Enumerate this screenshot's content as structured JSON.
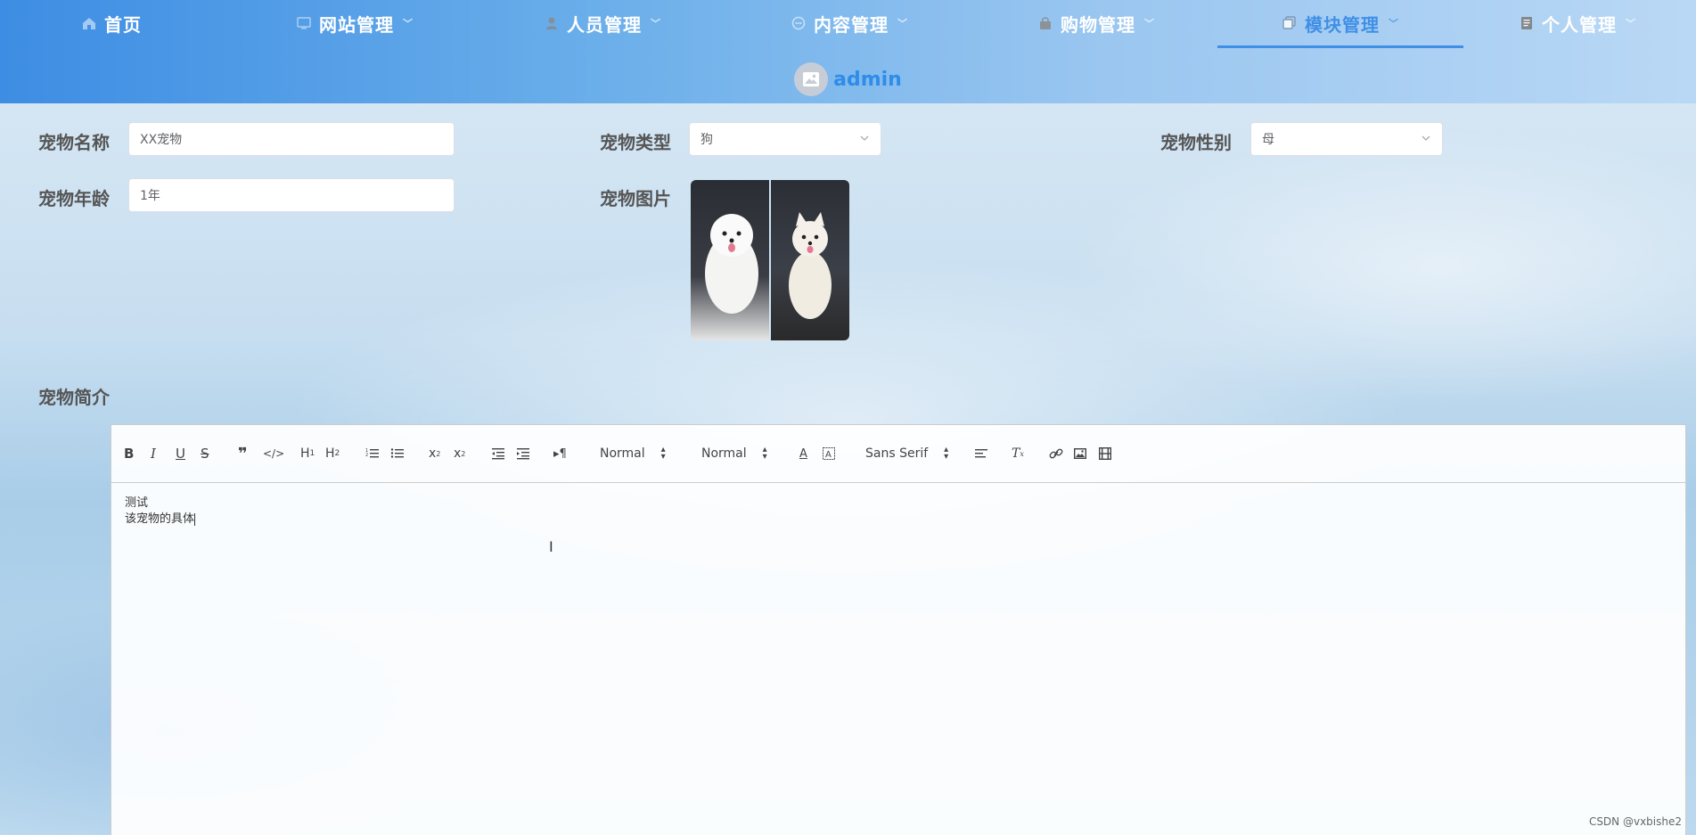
{
  "nav": {
    "items": [
      {
        "label": "首页",
        "icon": "home-icon",
        "dropdown": false,
        "active": false
      },
      {
        "label": "网站管理",
        "icon": "monitor-icon",
        "dropdown": true,
        "active": false
      },
      {
        "label": "人员管理",
        "icon": "user-icon",
        "dropdown": true,
        "active": false
      },
      {
        "label": "内容管理",
        "icon": "chat-icon",
        "dropdown": true,
        "active": false
      },
      {
        "label": "购物管理",
        "icon": "bag-icon",
        "dropdown": true,
        "active": false
      },
      {
        "label": "模块管理",
        "icon": "copy-icon",
        "dropdown": true,
        "active": true
      },
      {
        "label": "个人管理",
        "icon": "document-icon",
        "dropdown": true,
        "active": false
      }
    ],
    "active_color": "#3f8fe6"
  },
  "user": {
    "name": "admin"
  },
  "form": {
    "pet_name": {
      "label": "宠物名称",
      "value": "XX宠物"
    },
    "pet_type": {
      "label": "宠物类型",
      "value": "狗"
    },
    "pet_gender": {
      "label": "宠物性别",
      "value": "母"
    },
    "pet_age": {
      "label": "宠物年龄",
      "value": "1年"
    },
    "pet_image": {
      "label": "宠物图片"
    },
    "pet_intro": {
      "label": "宠物简介"
    }
  },
  "editor": {
    "toolbar": {
      "header_select": "Normal",
      "size_select": "Normal",
      "font_select": "Sans Serif"
    },
    "content_lines": [
      "测试",
      "该宠物的具体"
    ]
  },
  "watermark": "CSDN @vxbishe2"
}
